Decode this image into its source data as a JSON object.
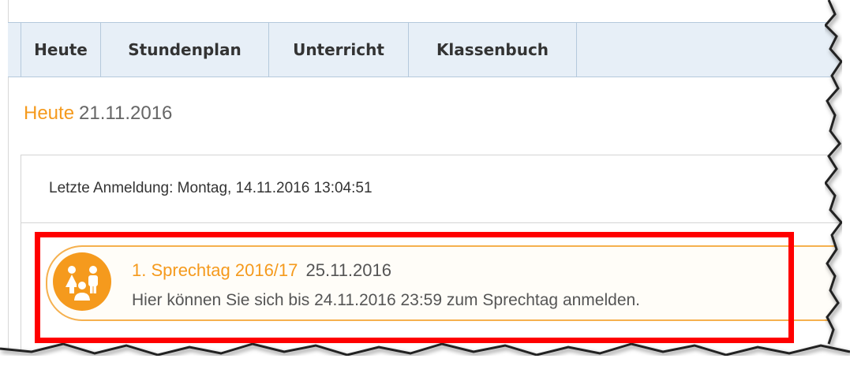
{
  "tabs": [
    {
      "label": "Heute"
    },
    {
      "label": "Stundenplan"
    },
    {
      "label": "Unterricht"
    },
    {
      "label": "Klassenbuch"
    }
  ],
  "heading": {
    "title": "Heute",
    "date": "21.11.2016"
  },
  "last_login": "Letzte Anmeldung: Montag, 14.11.2016 13:04:51",
  "event": {
    "name": "1. Sprechtag 2016/17",
    "date": "25.11.2016",
    "description": "Hier können Sie sich bis 24.11.2016 23:59 zum Sprechtag anmelden.",
    "icon": "people-group-icon"
  },
  "colors": {
    "accent": "#f59a1d",
    "tabbar_bg": "#e7eff7",
    "highlight": "#ff0000"
  }
}
